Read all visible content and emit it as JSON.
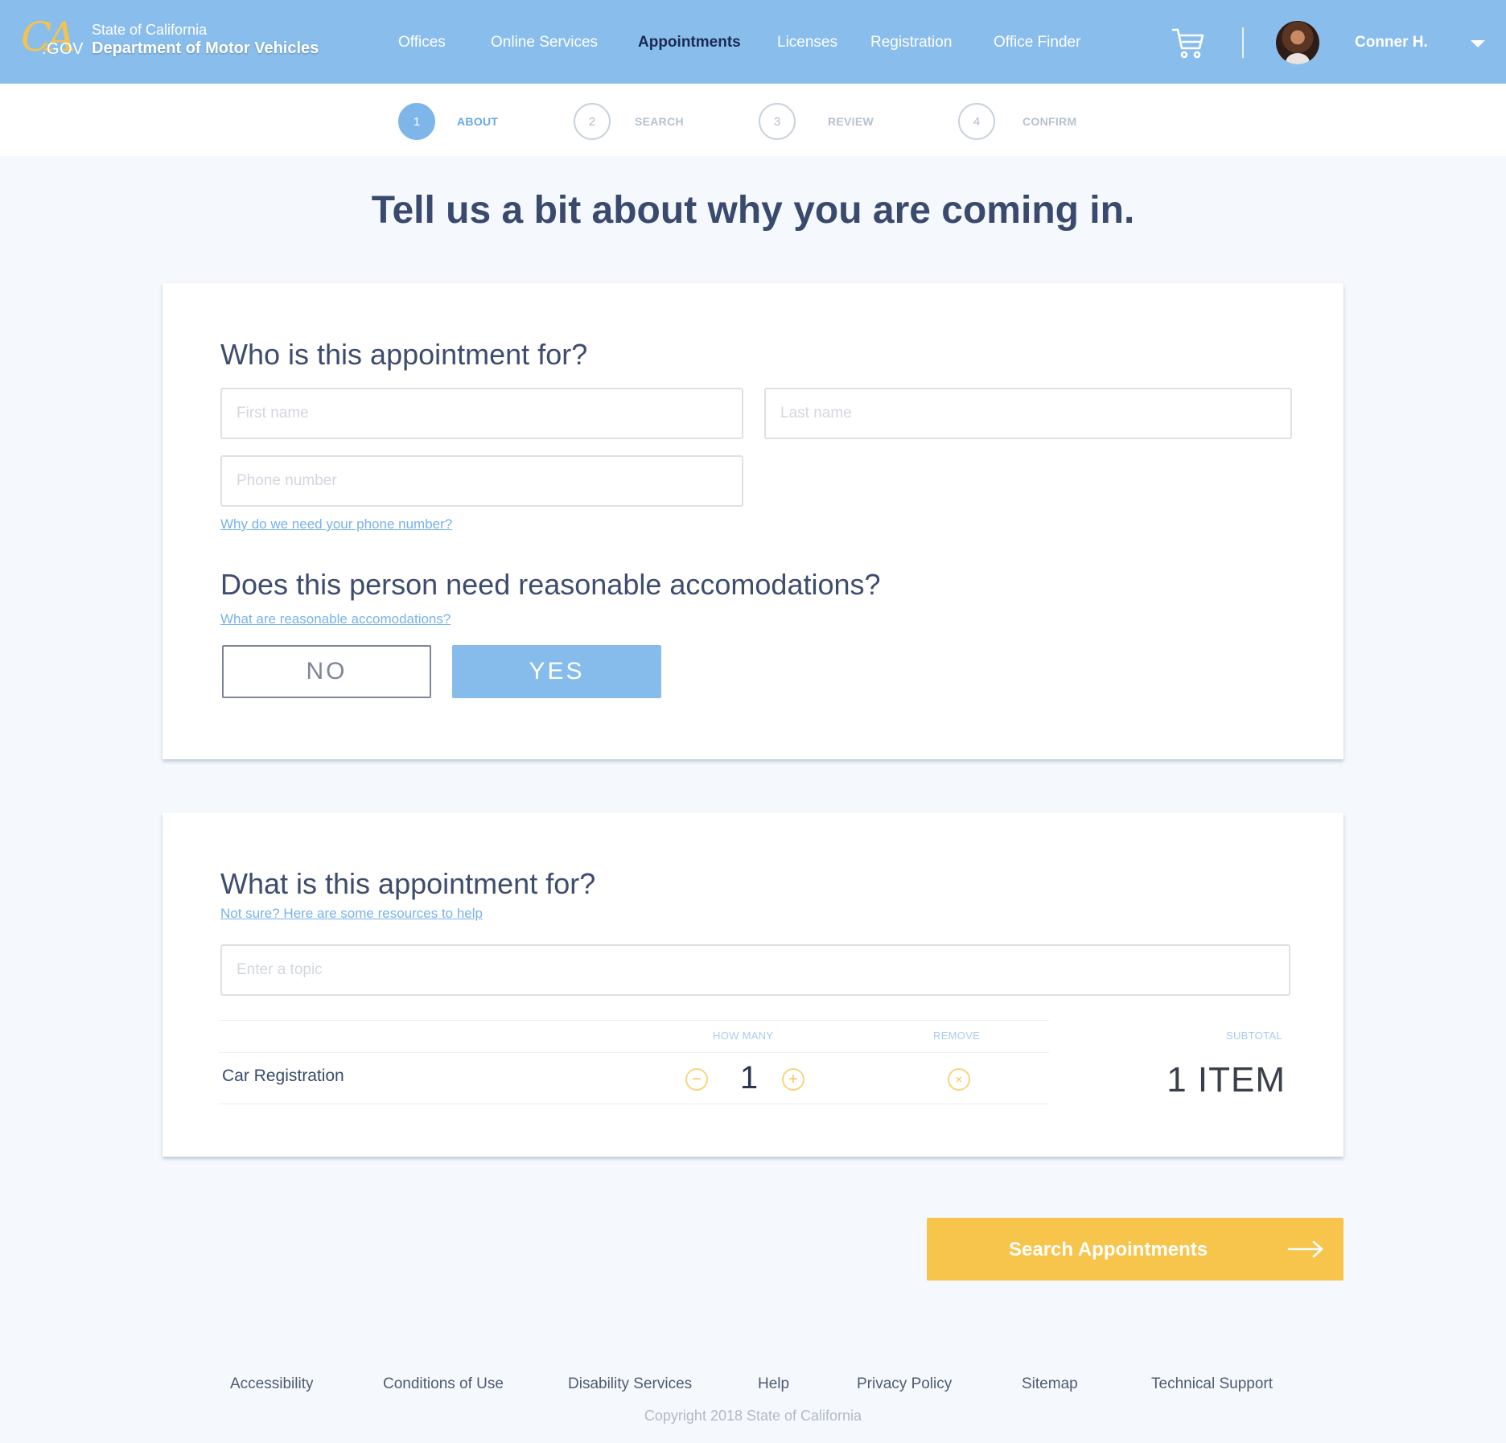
{
  "header": {
    "logo_text_ca": "CA",
    "logo_text_gov": ".GOV",
    "state": "State of California",
    "department": "Department of Motor Vehicles",
    "nav": [
      {
        "label": "Offices"
      },
      {
        "label": "Online Services"
      },
      {
        "label": "Appointments",
        "active": true
      },
      {
        "label": "Licenses"
      },
      {
        "label": "Registration"
      },
      {
        "label": "Office Finder"
      }
    ],
    "cart_icon": "shopping-cart-icon",
    "user_name": "Conner H."
  },
  "stepper": {
    "steps": [
      {
        "number": "1",
        "label": "ABOUT",
        "active": true
      },
      {
        "number": "2",
        "label": "SEARCH"
      },
      {
        "number": "3",
        "label": "REVIEW"
      },
      {
        "number": "4",
        "label": "CONFIRM"
      }
    ]
  },
  "page": {
    "title": "Tell us a bit about why you are coming in."
  },
  "who": {
    "heading": "Who is this appointment for?",
    "first_name_placeholder": "First name",
    "last_name_placeholder": "Last name",
    "phone_placeholder": "Phone number",
    "phone_help": "Why do we need your phone number?"
  },
  "accommodations": {
    "heading": "Does this person need reasonable accomodations?",
    "help": "What are reasonable accomodations?",
    "no_label": "NO",
    "yes_label": "YES",
    "selected": "YES"
  },
  "what": {
    "heading": "What is this appointment for?",
    "help": "Not sure? Here are some resources to help",
    "topic_placeholder": "Enter a topic",
    "columns": {
      "how_many": "HOW MANY",
      "remove": "REMOVE",
      "subtotal": "SUBTOTAL"
    },
    "items": [
      {
        "name": "Car Registration",
        "quantity": "1"
      }
    ],
    "subtotal": "1 ITEM"
  },
  "cta": {
    "label": "Search Appointments",
    "icon": "arrow-right-icon"
  },
  "footer": {
    "links": [
      "Accessibility",
      "Conditions of Use",
      "Disability Services",
      "Help",
      "Privacy Policy",
      "Sitemap",
      "Technical Support"
    ],
    "copyright": "Copyright 2018 State of California"
  },
  "colors": {
    "header_bg": "#89bdec",
    "accent_blue": "#7fb6ea",
    "accent_yellow": "#f7c44c",
    "page_bg": "#f5f9fd",
    "heading_text": "#3a4a6e"
  }
}
